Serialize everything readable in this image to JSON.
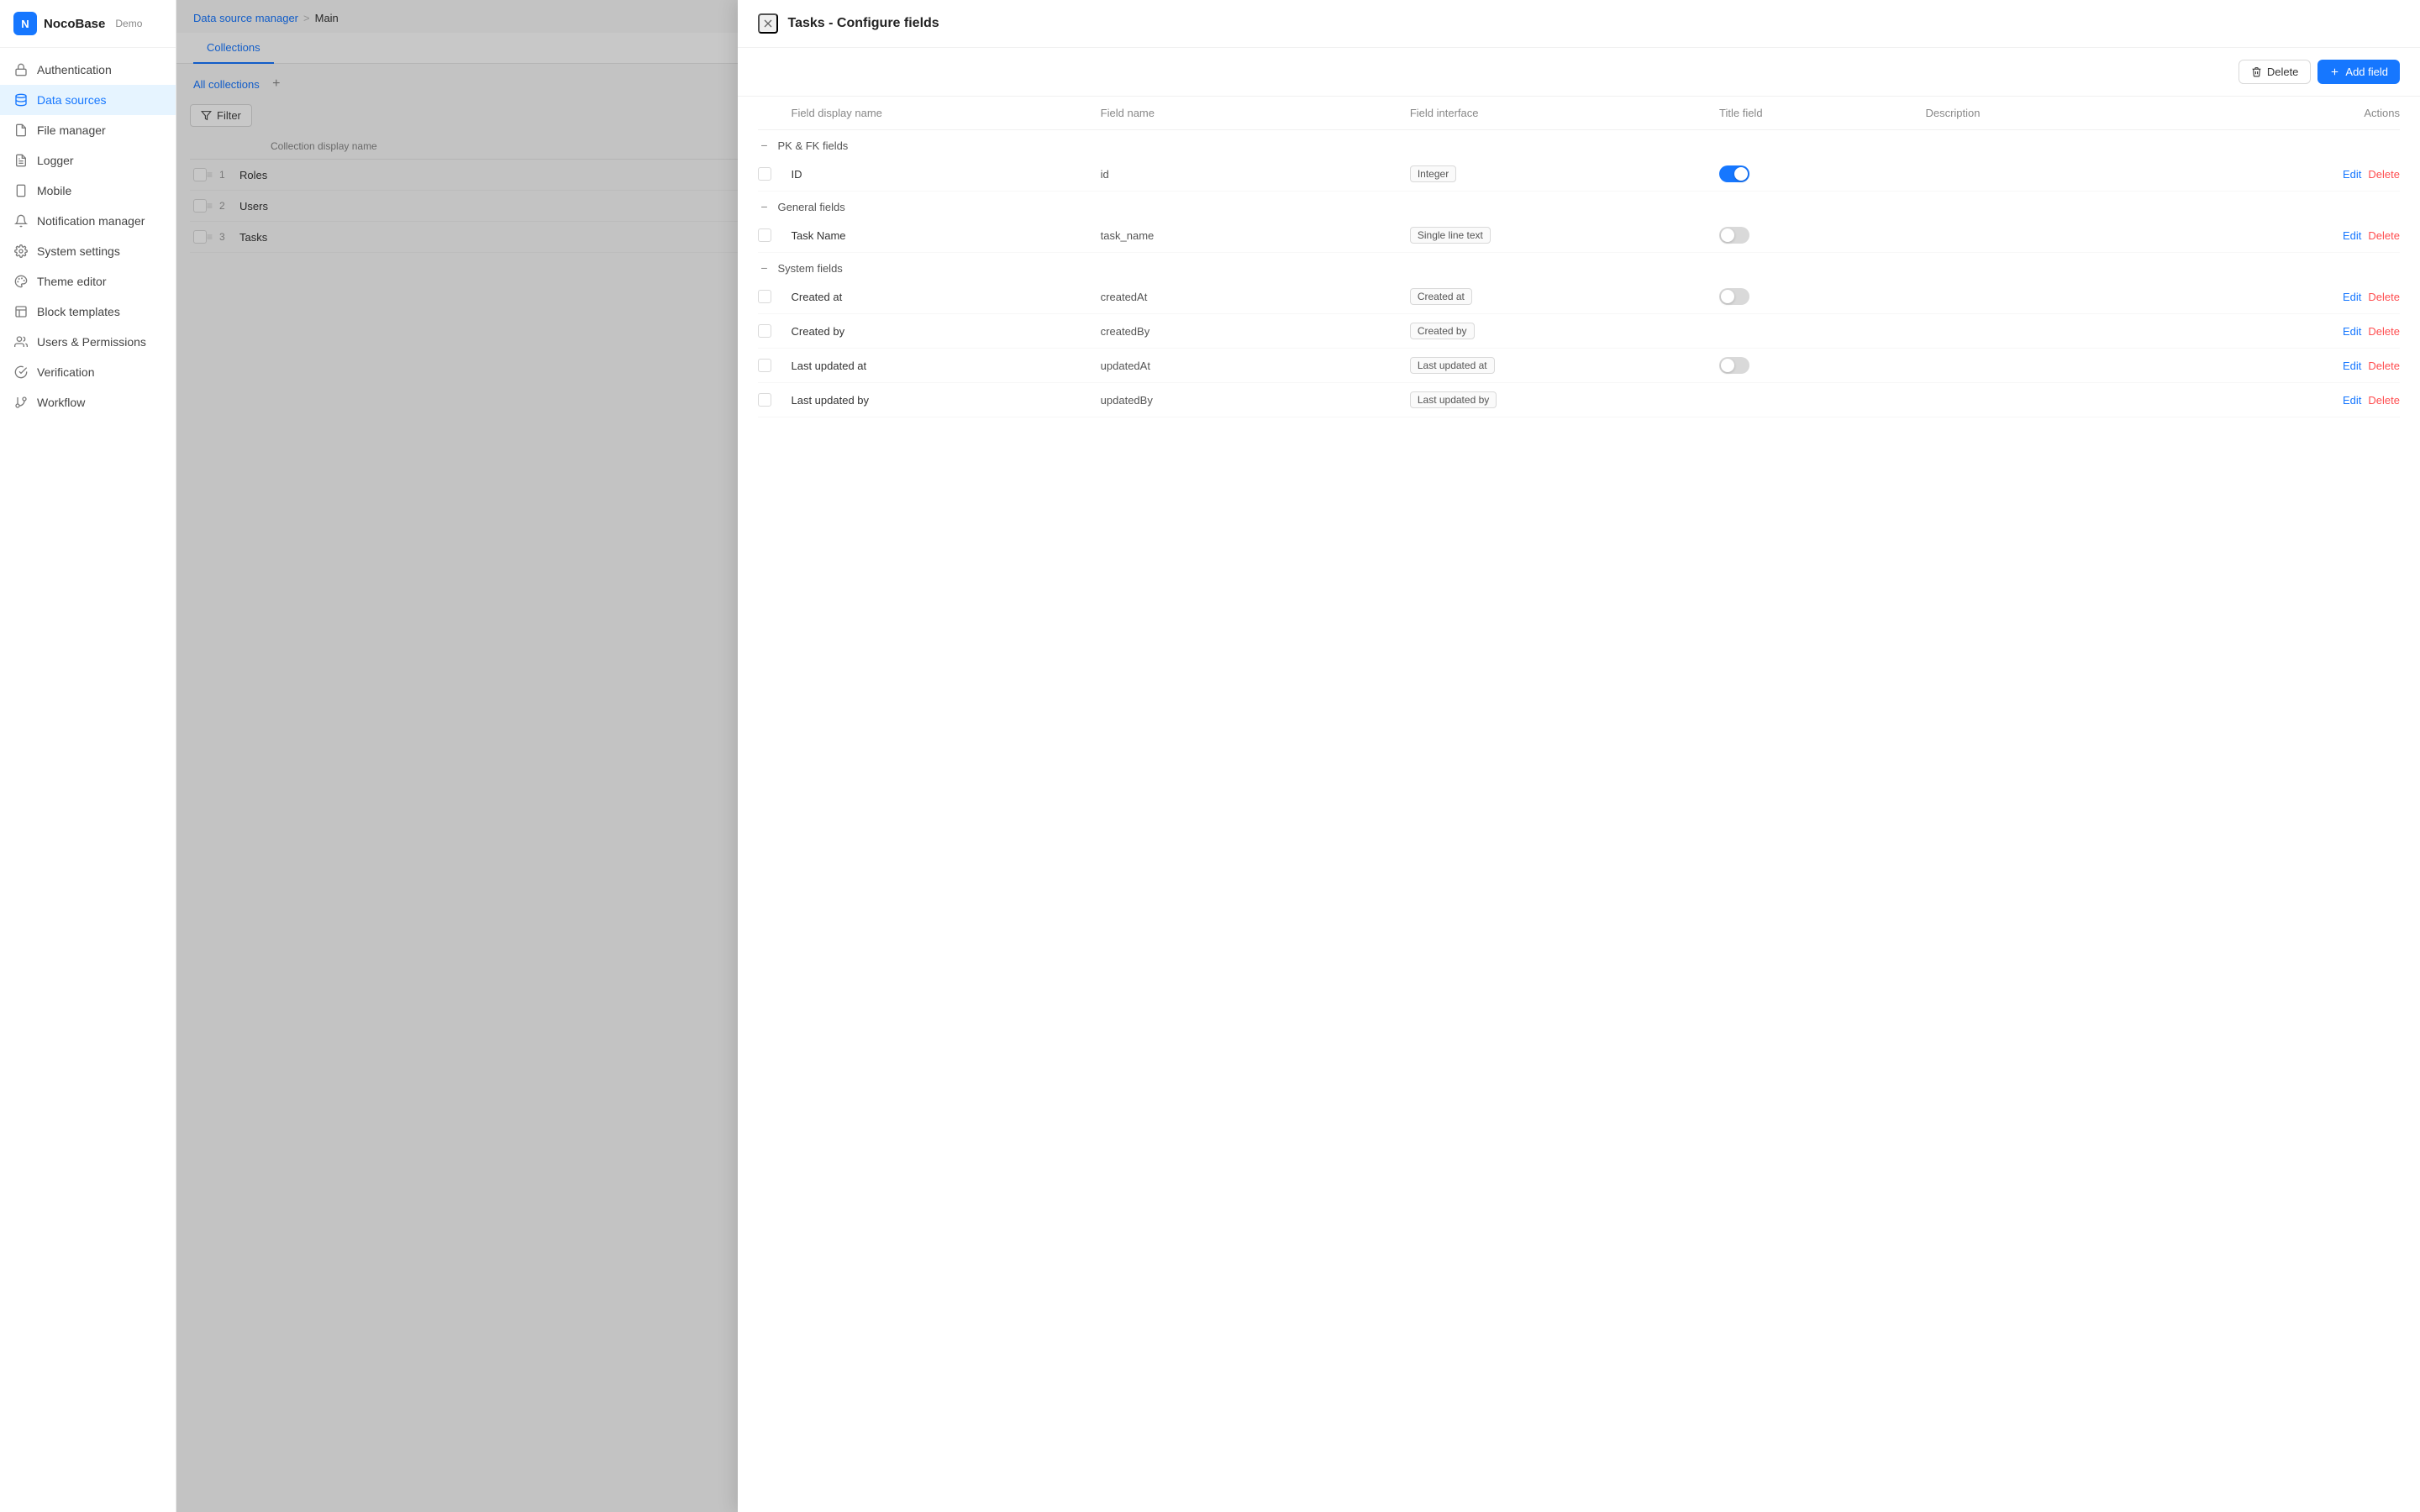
{
  "app": {
    "name": "NocoBase",
    "instance": "Demo"
  },
  "sidebar": {
    "items": [
      {
        "id": "authentication",
        "label": "Authentication",
        "icon": "lock"
      },
      {
        "id": "data-sources",
        "label": "Data sources",
        "icon": "database",
        "active": true
      },
      {
        "id": "file-manager",
        "label": "File manager",
        "icon": "file"
      },
      {
        "id": "logger",
        "label": "Logger",
        "icon": "file-text"
      },
      {
        "id": "mobile",
        "label": "Mobile",
        "icon": "smartphone"
      },
      {
        "id": "notification-manager",
        "label": "Notification manager",
        "icon": "bell"
      },
      {
        "id": "system-settings",
        "label": "System settings",
        "icon": "settings"
      },
      {
        "id": "theme-editor",
        "label": "Theme editor",
        "icon": "palette"
      },
      {
        "id": "block-templates",
        "label": "Block templates",
        "icon": "layout"
      },
      {
        "id": "users-permissions",
        "label": "Users & Permissions",
        "icon": "users"
      },
      {
        "id": "verification",
        "label": "Verification",
        "icon": "check-circle"
      },
      {
        "id": "workflow",
        "label": "Workflow",
        "icon": "git-branch"
      }
    ]
  },
  "breadcrumb": {
    "link_label": "Data source manager",
    "separator": ">",
    "current": "Main"
  },
  "tabs": [
    {
      "id": "collections",
      "label": "Collections",
      "active": true
    }
  ],
  "collections_toolbar": {
    "all_collections": "All collections",
    "filter_label": "Filter"
  },
  "collection_table": {
    "header": "Collection display name",
    "rows": [
      {
        "num": 1,
        "name": "Roles"
      },
      {
        "num": 2,
        "name": "Users"
      },
      {
        "num": 3,
        "name": "Tasks"
      }
    ]
  },
  "modal": {
    "title": "Tasks - Configure fields",
    "delete_btn": "Delete",
    "add_field_btn": "Add field",
    "table_headers": {
      "display_name": "Field display name",
      "field_name": "Field name",
      "interface": "Field interface",
      "title_field": "Title field",
      "description": "Description",
      "actions": "Actions"
    },
    "sections": [
      {
        "id": "pk-fk",
        "label": "PK & FK fields",
        "fields": [
          {
            "display_name": "ID",
            "field_name": "id",
            "interface": "Integer",
            "title_toggle": true,
            "description": "",
            "edit": "Edit",
            "delete": "Delete"
          }
        ]
      },
      {
        "id": "general",
        "label": "General fields",
        "fields": [
          {
            "display_name": "Task Name",
            "field_name": "task_name",
            "interface": "Single line text",
            "title_toggle": false,
            "description": "",
            "edit": "Edit",
            "delete": "Delete"
          }
        ]
      },
      {
        "id": "system",
        "label": "System fields",
        "fields": [
          {
            "display_name": "Created at",
            "field_name": "createdAt",
            "interface": "Created at",
            "title_toggle": false,
            "description": "",
            "edit": "Edit",
            "delete": "Delete"
          },
          {
            "display_name": "Created by",
            "field_name": "createdBy",
            "interface": "Created by",
            "title_toggle": null,
            "description": "",
            "edit": "Edit",
            "delete": "Delete"
          },
          {
            "display_name": "Last updated at",
            "field_name": "updatedAt",
            "interface": "Last updated at",
            "title_toggle": false,
            "description": "",
            "edit": "Edit",
            "delete": "Delete"
          },
          {
            "display_name": "Last updated by",
            "field_name": "updatedBy",
            "interface": "Last updated by",
            "title_toggle": null,
            "description": "",
            "edit": "Edit",
            "delete": "Delete"
          }
        ]
      }
    ]
  }
}
